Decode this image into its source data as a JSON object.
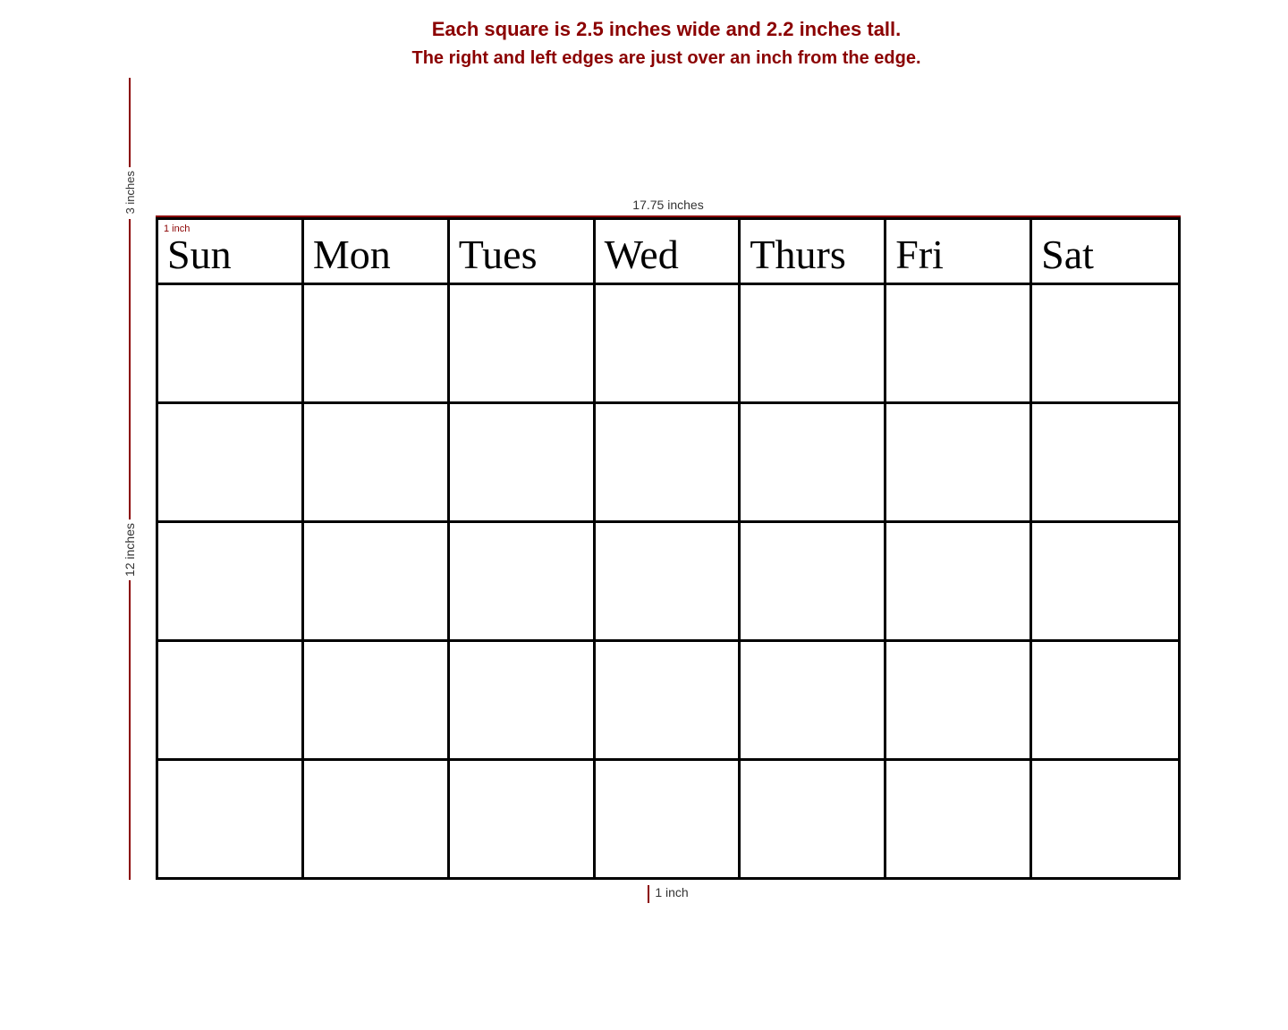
{
  "info": {
    "line1": "Each square is 2.5 inches wide and 2.2 inches tall.",
    "line2": "The right and left edges are just over an inch from the edge."
  },
  "measurements": {
    "top_vertical": "3 inches",
    "horizontal": "17.75 inches",
    "left_vertical": "12 inches",
    "bottom_inch": "1 inch",
    "corner_inch": "1 inch"
  },
  "calendar": {
    "days": [
      "Sun",
      "Mon",
      "Tues",
      "Wed",
      "Thurs",
      "Fri",
      "Sat"
    ],
    "rows": 5
  }
}
